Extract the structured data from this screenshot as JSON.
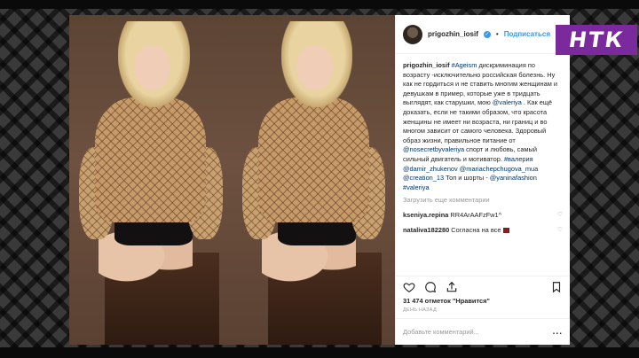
{
  "header": {
    "username": "prigozhin_iosif",
    "separator": "•",
    "follow_label": "Подписаться"
  },
  "caption": {
    "author": "prigozhin_iosif",
    "tag_ageism": "#Ageism",
    "text1": " дискриминация по возрасту -исключительно российская болезнь. Ну как не гордиться и не ставить многим женщинам и девушкам в пример, которые уже в тридцать выглядят, как старушки, мою ",
    "tag_valeriya": "@valeriya",
    "text2": " . Как ещё доказать, если не такими образом, что красота женщины не имеет ни возраста, ни границ и во многом зависит от самого человека. Здоровый образ жизни, правильное питание от ",
    "tag_nosecret": "@nosecretbyvaleriya",
    "text3": " спорт и любовь, самый сильный двигатель и мотиватор. ",
    "tag_hash_valeriya": "#валерия",
    "tag_damir": "@damir_zhukenov",
    "tag_maria": "@mariachepchugova_mua",
    "tag_creation": "@creation_13",
    "text4": "Топ и шорты - ",
    "tag_yanina": "@yaninafashion",
    "tag_hash_valeriya2": "#valeriya"
  },
  "load_more_label": "Загрузить еще комментарии",
  "comments": [
    {
      "author": "kseniya.repina",
      "text": "RR4ArAAFzFw1^"
    },
    {
      "author": "nataliva182280",
      "text": "Согласна на все"
    }
  ],
  "likes": {
    "count": "31 474",
    "text": "отметок \"Нравится\""
  },
  "time_label": "день назад",
  "add_comment_placeholder": "Добавьте комментарий...",
  "more_label": "...",
  "logo_text": "НТК",
  "colors": {
    "link": "#003569",
    "follow": "#3897f0",
    "logo_bg": "#7a2a9c"
  }
}
